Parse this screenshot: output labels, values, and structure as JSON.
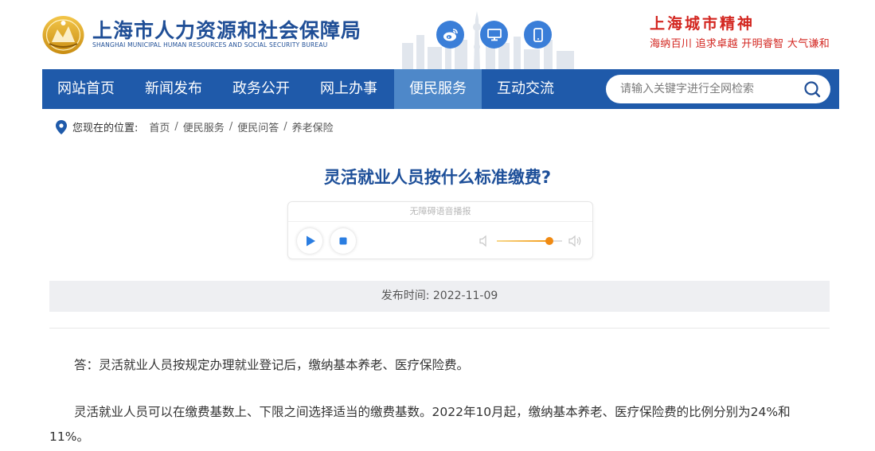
{
  "header": {
    "title": "上海市人力资源和社会保障局",
    "subtitle": "SHANGHAI MUNICIPAL HUMAN RESOURCES AND SOCIAL SECURITY BUREAU",
    "social_icons": [
      "weibo-icon",
      "desktop-icon",
      "mobile-icon"
    ],
    "slogan_title": "上海城市精神",
    "slogan_text": "海纳百川  追求卓越  开明睿智  大气谦和"
  },
  "nav": {
    "items": [
      {
        "label": "网站首页",
        "active": false
      },
      {
        "label": "新闻发布",
        "active": false
      },
      {
        "label": "政务公开",
        "active": false
      },
      {
        "label": "网上办事",
        "active": false
      },
      {
        "label": "便民服务",
        "active": true
      },
      {
        "label": "互动交流",
        "active": false
      }
    ],
    "search_placeholder": "请输入关键字进行全网检索"
  },
  "breadcrumb": {
    "label": "您现在的位置:",
    "items": [
      "首页",
      "便民服务",
      "便民问答",
      "养老保险"
    ]
  },
  "article": {
    "title": "灵活就业人员按什么标准缴费?",
    "player_caption": "无障碍语音播报",
    "volume_level": 0.8,
    "date_label": "发布时间: 2022-11-09",
    "paragraphs": [
      "答：灵活就业人员按规定办理就业登记后，缴纳基本养老、医疗保险费。",
      "灵活就业人员可以在缴费基数上、下限之间选择适当的缴费基数。2022年10月起，缴纳基本养老、医疗保险费的比例分别为24%和11%。"
    ]
  },
  "colors": {
    "nav_bg": "#1f5aaa",
    "nav_active": "#4e88c9",
    "title_blue": "#1d4f99",
    "slogan_red": "#d32620",
    "social_blue": "#3a7ed8",
    "volume_orange": "#f08a12"
  }
}
